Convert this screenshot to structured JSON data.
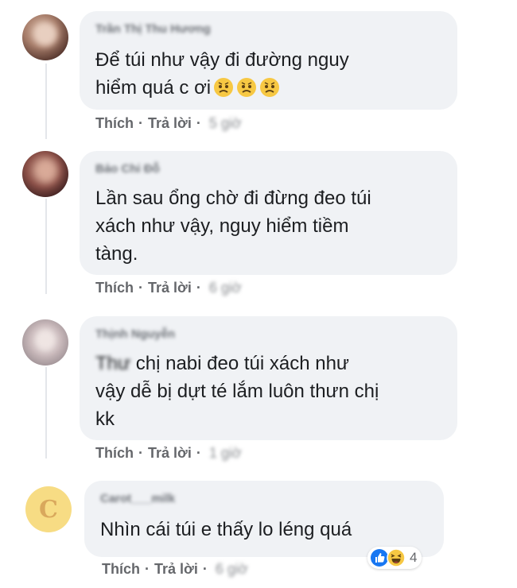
{
  "comments": [
    {
      "author": "Trần Thị Thu Hương",
      "text": "Để túi như vậy đi đường nguy\nhiểm quá c ơi",
      "emoji_count": 3,
      "like_label": "Thích",
      "reply_label": "Trả lời",
      "time": "5 giờ"
    },
    {
      "author": "Bảo Chi Đỗ",
      "text": "Lần sau ổng chờ đi đừng đeo túi\nxách như vậy, nguy hiểm tiềm\ntàng.",
      "like_label": "Thích",
      "reply_label": "Trả lời",
      "time": "6 giờ"
    },
    {
      "author": "Thịnh Nguyễn",
      "mention": "Thư",
      "text": " chị nabi đeo túi xách như\nvậy dễ bị dựt té lắm luôn thưn chị\nkk",
      "like_label": "Thích",
      "reply_label": "Trả lời",
      "time": "1 giờ"
    },
    {
      "author": "Carot___milk",
      "avatar_letter": "C",
      "text": "Nhìn cái túi e thấy lo léng quá",
      "like_label": "Thích",
      "reply_label": "Trả lời",
      "time": "6 giờ",
      "reactions": {
        "types": [
          "like",
          "haha"
        ],
        "count": "4"
      }
    }
  ],
  "separator": "·"
}
